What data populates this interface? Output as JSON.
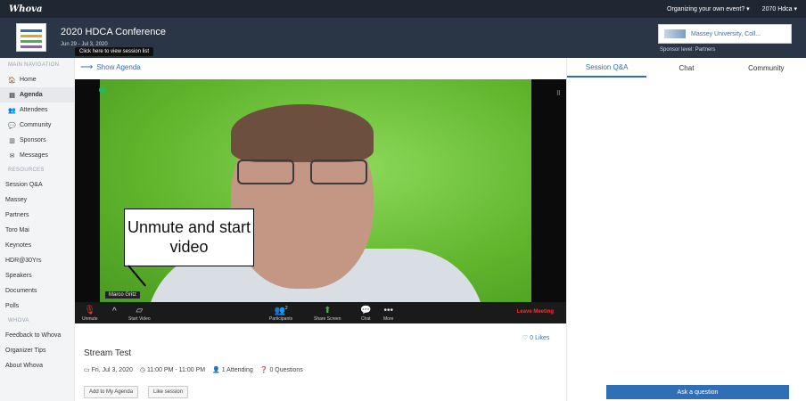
{
  "topbar": {
    "logo": "Whova",
    "organizing": "Organizing your own event? ▾",
    "account": "2070 Hdca ▾"
  },
  "event": {
    "title": "2020 HDCA Conference",
    "dates": "Jun 29 - Jul 3, 2020",
    "tooltip": "Click here to view session list"
  },
  "sponsor": {
    "name": "Massey University, Coll...",
    "level": "Sponsor level: Partners"
  },
  "sidebar": {
    "main_title": "MAIN NAVIGATION",
    "main_items": [
      {
        "icon": "🏠",
        "label": "Home"
      },
      {
        "icon": "▤",
        "label": "Agenda"
      },
      {
        "icon": "👥",
        "label": "Attendees"
      },
      {
        "icon": "💬",
        "label": "Community"
      },
      {
        "icon": "▥",
        "label": "Sponsors"
      },
      {
        "icon": "✉",
        "label": "Messages"
      }
    ],
    "resources_title": "RESOURCES",
    "resources": [
      "Session Q&A",
      "Massey",
      "Partners",
      "Toro Mai",
      "Keynotes",
      "HDR@30Yrs",
      "Speakers",
      "Documents",
      "Polls"
    ],
    "whova_title": "WHOVA",
    "whova_items": [
      "Feedback to Whova",
      "Organizer Tips",
      "About Whova"
    ]
  },
  "agenda_link": "Show Agenda",
  "video": {
    "name_tag": "Marco Gritz",
    "callout": "Unmute and start video",
    "controls": {
      "unmute": "Unmute",
      "start_video": "Start Video",
      "participants": "Participants",
      "participants_count": "2",
      "share_screen": "Share Screen",
      "chat": "Chat",
      "more": "More",
      "leave": "Leave Meeting"
    }
  },
  "session": {
    "likes": "0 Likes",
    "title": "Stream Test",
    "date": "Fri, Jul 3, 2020",
    "time": "11:00 PM - 11:00 PM",
    "attending": "1 Attending",
    "questions": "0 Questions",
    "add_button": "Add to My Agenda",
    "like_button": "Like session"
  },
  "right": {
    "tabs": [
      "Session Q&A",
      "Chat",
      "Community"
    ],
    "ask_button": "Ask a question"
  }
}
